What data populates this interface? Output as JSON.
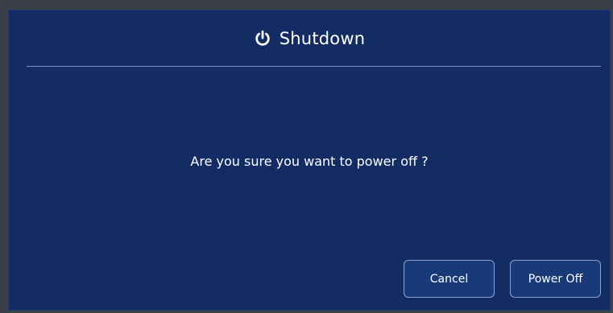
{
  "dialog": {
    "title": "Shutdown",
    "title_icon": "power-icon",
    "message": "Are you sure you want to power off ?",
    "buttons": {
      "cancel_label": "Cancel",
      "power_off_label": "Power Off"
    }
  },
  "colors": {
    "dialog_background": "#132d64",
    "divider": "#7f93b8",
    "button_border": "#8ea3c8",
    "text": "#ffffff"
  }
}
